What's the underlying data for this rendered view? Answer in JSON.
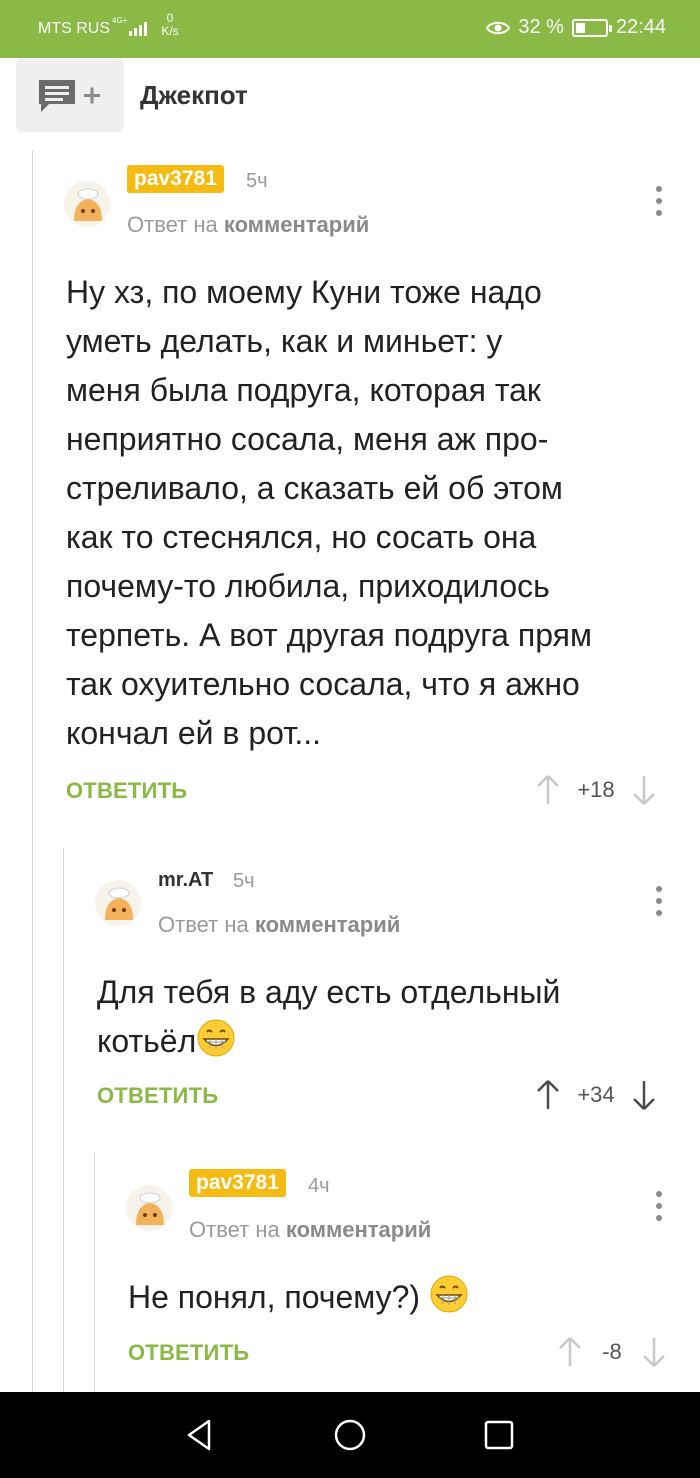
{
  "status_bar": {
    "carrier": "MTS RUS",
    "network": "4G+",
    "speed_value": "0",
    "speed_unit": "K/s",
    "battery": "32 %",
    "time": "22:44",
    "background": "#8ab945"
  },
  "header": {
    "title": "Джекпот",
    "action_icon": "add-comment-icon"
  },
  "comments": [
    {
      "author": "pav3781",
      "author_style": "badge",
      "time": "5ч",
      "reply_prefix": "Ответ на",
      "reply_target": "комментарий",
      "text": "Ну хз, по моему Куни тоже надо\nуметь делать, как и миньет: у\nменя была подруга, которая так\nнеприятно сосала, меня аж про-\nстреливало, а сказать ей об этом\nкак то стеснялся, но сосать она\nпочему-то любила, приходилось\nтерпеть. А вот другая подруга прям\nтак охуительно сосала, что я ажно\nкончал ей в рот...",
      "reply_label": "ОТВЕТИТЬ",
      "score": "+18"
    },
    {
      "author": "mr.AT",
      "author_style": "plain",
      "time": "5ч",
      "reply_prefix": "Ответ на",
      "reply_target": "комментарий",
      "text": "Для тебя в аду есть отдельный\nкотьёл",
      "reply_label": "ОТВЕТИТЬ",
      "score": "+34"
    },
    {
      "author": "pav3781",
      "author_style": "badge",
      "time": "4ч",
      "reply_prefix": "Ответ на",
      "reply_target": "комментарий",
      "text": "Не понял, почему?) ",
      "reply_label": "ОТВЕТИТЬ",
      "score": "-8"
    }
  ],
  "colors": {
    "accent_green": "#8ab945",
    "author_badge": "#f4bb12",
    "muted_text": "#9a9a9a"
  }
}
